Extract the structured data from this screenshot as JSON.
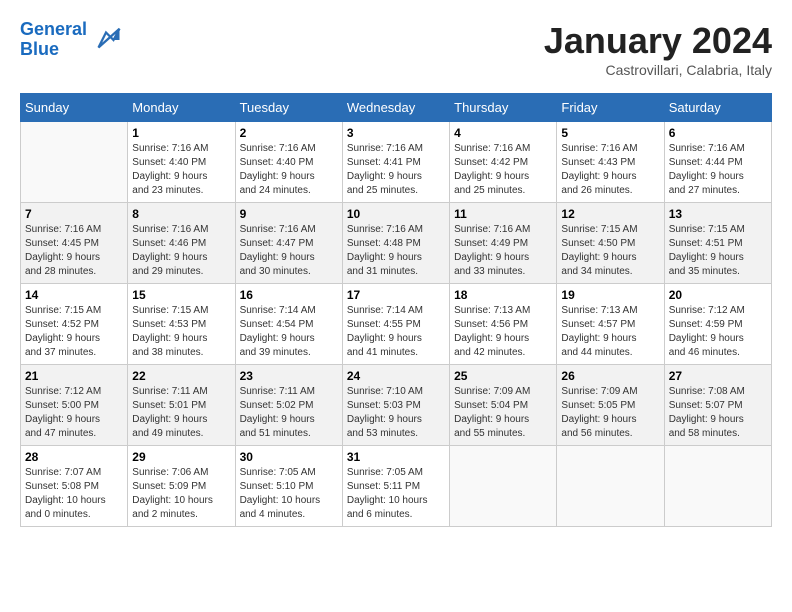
{
  "header": {
    "logo_line1": "General",
    "logo_line2": "Blue",
    "month": "January 2024",
    "location": "Castrovillari, Calabria, Italy"
  },
  "weekdays": [
    "Sunday",
    "Monday",
    "Tuesday",
    "Wednesday",
    "Thursday",
    "Friday",
    "Saturday"
  ],
  "weeks": [
    [
      {
        "day": "",
        "info": ""
      },
      {
        "day": "1",
        "info": "Sunrise: 7:16 AM\nSunset: 4:40 PM\nDaylight: 9 hours\nand 23 minutes."
      },
      {
        "day": "2",
        "info": "Sunrise: 7:16 AM\nSunset: 4:40 PM\nDaylight: 9 hours\nand 24 minutes."
      },
      {
        "day": "3",
        "info": "Sunrise: 7:16 AM\nSunset: 4:41 PM\nDaylight: 9 hours\nand 25 minutes."
      },
      {
        "day": "4",
        "info": "Sunrise: 7:16 AM\nSunset: 4:42 PM\nDaylight: 9 hours\nand 25 minutes."
      },
      {
        "day": "5",
        "info": "Sunrise: 7:16 AM\nSunset: 4:43 PM\nDaylight: 9 hours\nand 26 minutes."
      },
      {
        "day": "6",
        "info": "Sunrise: 7:16 AM\nSunset: 4:44 PM\nDaylight: 9 hours\nand 27 minutes."
      }
    ],
    [
      {
        "day": "7",
        "info": "Sunrise: 7:16 AM\nSunset: 4:45 PM\nDaylight: 9 hours\nand 28 minutes."
      },
      {
        "day": "8",
        "info": "Sunrise: 7:16 AM\nSunset: 4:46 PM\nDaylight: 9 hours\nand 29 minutes."
      },
      {
        "day": "9",
        "info": "Sunrise: 7:16 AM\nSunset: 4:47 PM\nDaylight: 9 hours\nand 30 minutes."
      },
      {
        "day": "10",
        "info": "Sunrise: 7:16 AM\nSunset: 4:48 PM\nDaylight: 9 hours\nand 31 minutes."
      },
      {
        "day": "11",
        "info": "Sunrise: 7:16 AM\nSunset: 4:49 PM\nDaylight: 9 hours\nand 33 minutes."
      },
      {
        "day": "12",
        "info": "Sunrise: 7:15 AM\nSunset: 4:50 PM\nDaylight: 9 hours\nand 34 minutes."
      },
      {
        "day": "13",
        "info": "Sunrise: 7:15 AM\nSunset: 4:51 PM\nDaylight: 9 hours\nand 35 minutes."
      }
    ],
    [
      {
        "day": "14",
        "info": "Sunrise: 7:15 AM\nSunset: 4:52 PM\nDaylight: 9 hours\nand 37 minutes."
      },
      {
        "day": "15",
        "info": "Sunrise: 7:15 AM\nSunset: 4:53 PM\nDaylight: 9 hours\nand 38 minutes."
      },
      {
        "day": "16",
        "info": "Sunrise: 7:14 AM\nSunset: 4:54 PM\nDaylight: 9 hours\nand 39 minutes."
      },
      {
        "day": "17",
        "info": "Sunrise: 7:14 AM\nSunset: 4:55 PM\nDaylight: 9 hours\nand 41 minutes."
      },
      {
        "day": "18",
        "info": "Sunrise: 7:13 AM\nSunset: 4:56 PM\nDaylight: 9 hours\nand 42 minutes."
      },
      {
        "day": "19",
        "info": "Sunrise: 7:13 AM\nSunset: 4:57 PM\nDaylight: 9 hours\nand 44 minutes."
      },
      {
        "day": "20",
        "info": "Sunrise: 7:12 AM\nSunset: 4:59 PM\nDaylight: 9 hours\nand 46 minutes."
      }
    ],
    [
      {
        "day": "21",
        "info": "Sunrise: 7:12 AM\nSunset: 5:00 PM\nDaylight: 9 hours\nand 47 minutes."
      },
      {
        "day": "22",
        "info": "Sunrise: 7:11 AM\nSunset: 5:01 PM\nDaylight: 9 hours\nand 49 minutes."
      },
      {
        "day": "23",
        "info": "Sunrise: 7:11 AM\nSunset: 5:02 PM\nDaylight: 9 hours\nand 51 minutes."
      },
      {
        "day": "24",
        "info": "Sunrise: 7:10 AM\nSunset: 5:03 PM\nDaylight: 9 hours\nand 53 minutes."
      },
      {
        "day": "25",
        "info": "Sunrise: 7:09 AM\nSunset: 5:04 PM\nDaylight: 9 hours\nand 55 minutes."
      },
      {
        "day": "26",
        "info": "Sunrise: 7:09 AM\nSunset: 5:05 PM\nDaylight: 9 hours\nand 56 minutes."
      },
      {
        "day": "27",
        "info": "Sunrise: 7:08 AM\nSunset: 5:07 PM\nDaylight: 9 hours\nand 58 minutes."
      }
    ],
    [
      {
        "day": "28",
        "info": "Sunrise: 7:07 AM\nSunset: 5:08 PM\nDaylight: 10 hours\nand 0 minutes."
      },
      {
        "day": "29",
        "info": "Sunrise: 7:06 AM\nSunset: 5:09 PM\nDaylight: 10 hours\nand 2 minutes."
      },
      {
        "day": "30",
        "info": "Sunrise: 7:05 AM\nSunset: 5:10 PM\nDaylight: 10 hours\nand 4 minutes."
      },
      {
        "day": "31",
        "info": "Sunrise: 7:05 AM\nSunset: 5:11 PM\nDaylight: 10 hours\nand 6 minutes."
      },
      {
        "day": "",
        "info": ""
      },
      {
        "day": "",
        "info": ""
      },
      {
        "day": "",
        "info": ""
      }
    ]
  ]
}
